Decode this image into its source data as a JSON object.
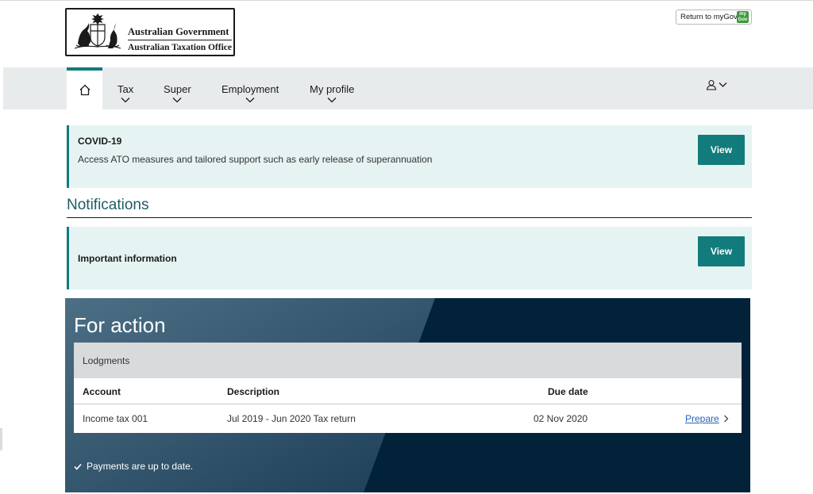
{
  "logo": {
    "line1": "Australian Government",
    "line2": "Australian Taxation Office"
  },
  "header": {
    "return_label": "Return to myGov",
    "mygov_badge": "my Gov"
  },
  "nav": {
    "items": [
      {
        "label": "Tax"
      },
      {
        "label": "Super"
      },
      {
        "label": "Employment"
      },
      {
        "label": "My profile"
      }
    ]
  },
  "covid": {
    "title": "COVID-19",
    "text": "Access ATO measures and tailored support such as early release of superannuation",
    "button": "View"
  },
  "notifications": {
    "heading": "Notifications",
    "important": {
      "title": "Important information",
      "button": "View"
    }
  },
  "for_action": {
    "title": "For action",
    "lodgments": {
      "heading": "Lodgments",
      "columns": [
        "Account",
        "Description",
        "Due date"
      ],
      "rows": [
        {
          "account": "Income tax 001",
          "description": "Jul 2019 - Jun 2020 Tax return",
          "due": "02 Nov 2020",
          "action": "Prepare"
        }
      ]
    },
    "payments_status": "Payments are up to date."
  },
  "colors": {
    "teal": "#127b7b",
    "navy": "#02223a",
    "banner_bg": "#e5f4f3",
    "link": "#2863b8"
  }
}
